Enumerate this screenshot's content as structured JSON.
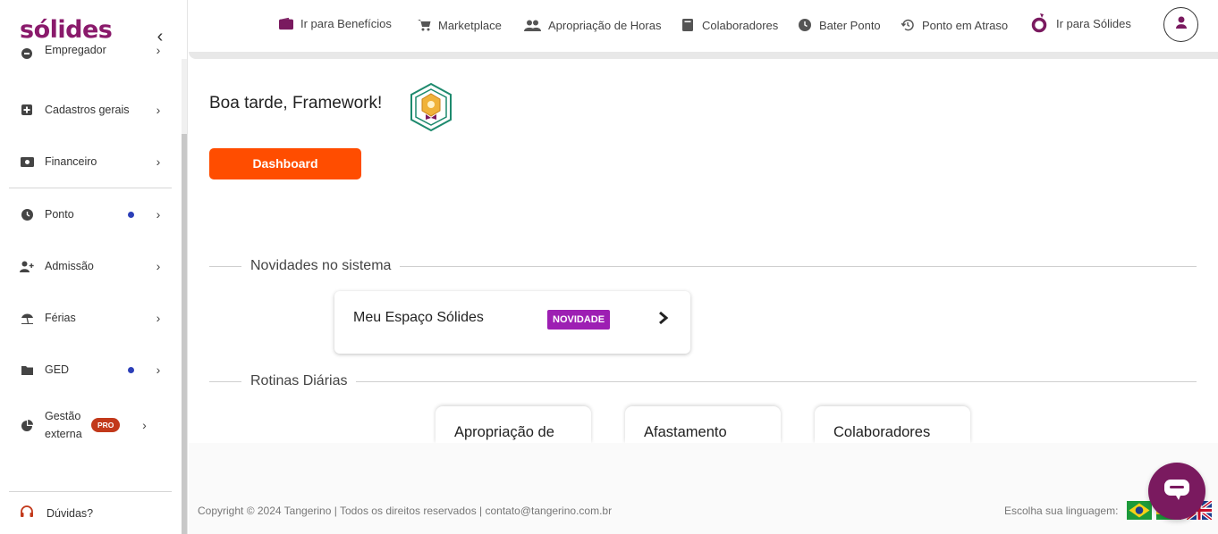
{
  "brand": {
    "logo_text": "sólides",
    "accent": "#8a1a6b"
  },
  "sidebar": {
    "items": [
      {
        "label": "Empregador",
        "icon": "employer-icon"
      },
      {
        "label": "Cadastros gerais",
        "icon": "plus-square-icon"
      },
      {
        "label": "Financeiro",
        "icon": "money-icon"
      },
      {
        "label": "Ponto",
        "icon": "clock-icon",
        "dot": true
      },
      {
        "label": "Admissão",
        "icon": "user-add-icon"
      },
      {
        "label": "Férias",
        "icon": "beach-umbrella-icon"
      },
      {
        "label": "GED",
        "icon": "folder-icon",
        "dot": true
      },
      {
        "label": "Gestão externa",
        "icon": "pie-chart-icon",
        "badge": "PRO"
      }
    ],
    "help_label": "Dúvidas?"
  },
  "topnav": {
    "links": [
      {
        "label": "Ir para Benefícios",
        "icon": "wallet-icon"
      },
      {
        "label": "Marketplace",
        "icon": "cart-icon"
      },
      {
        "label": "Apropriação de Horas",
        "icon": "users-icon"
      },
      {
        "label": "Colaboradores",
        "icon": "book-icon"
      },
      {
        "label": "Bater Ponto",
        "icon": "clock-icon"
      },
      {
        "label": "Ponto em Atraso",
        "icon": "history-icon"
      },
      {
        "label": "Ir para Sólides",
        "icon": "solides-icon"
      }
    ]
  },
  "main": {
    "greeting": "Boa tarde, Framework!",
    "dashboard_button": "Dashboard",
    "news_section_title": "Novidades no sistema",
    "news_card": {
      "title": "Meu Espaço Sólides",
      "badge": "NOVIDADE"
    },
    "routines_section_title": "Rotinas Diárias",
    "routines": [
      "Apropriação de",
      "Afastamento",
      "Colaboradores"
    ]
  },
  "footer": {
    "copyright": "Copyright © 2024 Tangerino | Todos os direitos reservados | contato@tangerino.com.br",
    "language_label": "Escolha sua linguagem:"
  },
  "colors": {
    "primary_button": "#ff4d00",
    "badge_new": "#9d1fb3",
    "badge_pro": "#c2391b",
    "dot": "#2c3fb8"
  }
}
